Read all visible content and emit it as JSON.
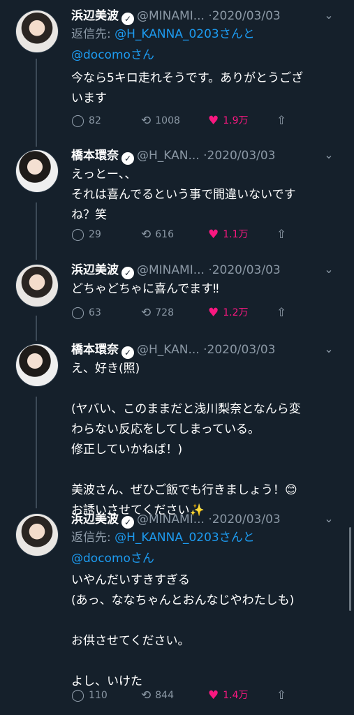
{
  "tweets": [
    {
      "name": "浜辺美波",
      "handle": "@MINAMI...",
      "dot": "·",
      "date": "2020/03/03",
      "reply_prefix": "返信先: ",
      "reply_mention1": "@H_KANNA_0203さんと",
      "reply_mention2": "@docomoさん",
      "text": "今なら5キロ走れそうです。ありがとうござ\nいます",
      "replies": "82",
      "retweets": "1008",
      "likes": "1.9万"
    },
    {
      "name": "橋本環奈",
      "handle": "@H_KAN...",
      "dot": "·",
      "date": "2020/03/03",
      "text": "えっとー、、\nそれは喜んでるという事で間違いないです\nね？笑",
      "replies": "29",
      "retweets": "616",
      "likes": "1.1万"
    },
    {
      "name": "浜辺美波",
      "handle": "@MINAMI...",
      "dot": "·",
      "date": "2020/03/03",
      "text": "どちゃどちゃに喜んでます‼",
      "replies": "63",
      "retweets": "728",
      "likes": "1.2万"
    },
    {
      "name": "橋本環奈",
      "handle": "@H_KAN...",
      "dot": "·",
      "date": "2020/03/03",
      "text": "え、好き(照)\n\n(ヤバい、このままだと浅川梨奈となんら変\nわらない反応をしてしまっている。\n修正していかねば！)\n\n美波さん、ぜひご飯でも行きましょう！😊\nお誘いさせてください✨"
    },
    {
      "name": "浜辺美波",
      "handle": "@MINAMI...",
      "dot": "·",
      "date": "2020/03/03",
      "reply_prefix": "返信先: ",
      "reply_mention1": "@H_KANNA_0203さんと",
      "reply_mention2": "@docomoさん",
      "text": "いやんだいすきすぎる\n(あっ、ななちゃんとおんなじやわたしも)\n\nお供させてください。\n\nよし、いけた",
      "replies": "110",
      "retweets": "844",
      "likes": "1.4万"
    }
  ],
  "icons": {
    "verified": "✓",
    "chevron": "⌄",
    "reply": "◯",
    "retweet": "⟲",
    "like": "♥",
    "share": "⇧"
  }
}
